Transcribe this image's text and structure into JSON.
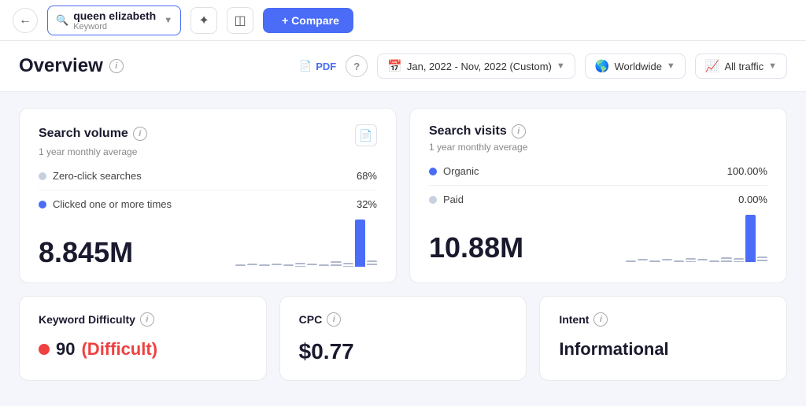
{
  "nav": {
    "back_label": "←",
    "keyword": "queen elizabeth",
    "keyword_type": "Keyword",
    "magic_icon": "✦",
    "split_icon": "⊞",
    "compare_label": "+ Compare"
  },
  "header": {
    "title": "Overview",
    "pdf_label": "PDF",
    "help_label": "?",
    "date_range": "Jan, 2022 - Nov, 2022 (Custom)",
    "location": "Worldwide",
    "traffic": "All traffic"
  },
  "search_volume": {
    "title": "Search volume",
    "info": "i",
    "subtitle": "1 year monthly average",
    "legend": [
      {
        "label": "Zero-click searches",
        "color": "#c8d0e0",
        "pct": "68%"
      },
      {
        "label": "Clicked one or more times",
        "color": "#4a6cf7",
        "pct": "32%"
      }
    ],
    "metric": "8.845M"
  },
  "search_visits": {
    "title": "Search visits",
    "info": "i",
    "subtitle": "1 year monthly average",
    "legend": [
      {
        "label": "Organic",
        "color": "#4a6cf7",
        "pct": "100.00%"
      },
      {
        "label": "Paid",
        "color": "#c8d0e0",
        "pct": "0.00%"
      }
    ],
    "metric": "10.88M"
  },
  "keyword_difficulty": {
    "title": "Keyword Difficulty",
    "info": "i",
    "value": "90",
    "label": "(Difficult)"
  },
  "cpc": {
    "title": "CPC",
    "info": "i",
    "value": "$0.77"
  },
  "intent": {
    "title": "Intent",
    "info": "i",
    "value": "Informational"
  },
  "chart_sv": {
    "bars": [
      2,
      3,
      2,
      3,
      2,
      4,
      3,
      2,
      5,
      4,
      45,
      6
    ]
  },
  "chart_sv2": {
    "bars": [
      2,
      3,
      2,
      3,
      2,
      4,
      3,
      2,
      5,
      4,
      48,
      6
    ]
  }
}
